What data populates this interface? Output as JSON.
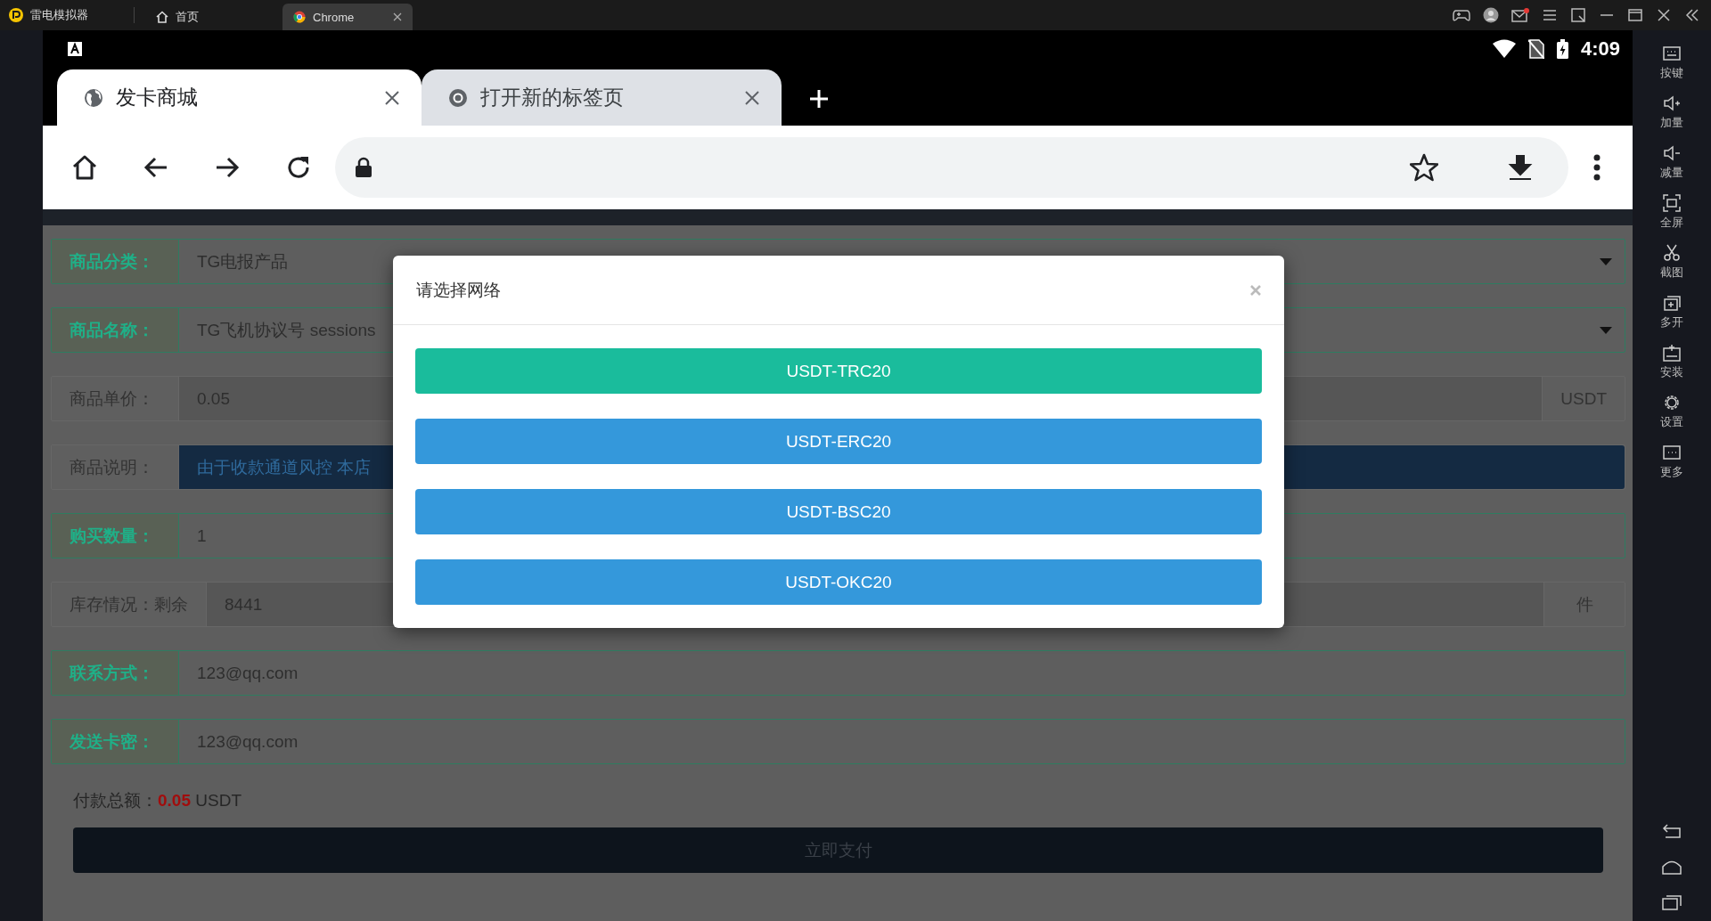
{
  "emulator": {
    "app_name": "雷电模拟器",
    "tabs": [
      {
        "label": "首页",
        "selected": false
      },
      {
        "label": "Chrome",
        "selected": true
      }
    ]
  },
  "sidebar": {
    "items": [
      {
        "label": "按键"
      },
      {
        "label": "加量"
      },
      {
        "label": "减量"
      },
      {
        "label": "全屏"
      },
      {
        "label": "截图"
      },
      {
        "label": "多开"
      },
      {
        "label": "安装"
      },
      {
        "label": "设置"
      },
      {
        "label": "更多"
      }
    ]
  },
  "status_bar": {
    "time": "4:09"
  },
  "browser": {
    "tabs": [
      {
        "title": "发卡商城",
        "selected": true
      },
      {
        "title": "打开新的标签页",
        "selected": false
      }
    ]
  },
  "form": {
    "rows": [
      {
        "label": "商品分类：",
        "value": "TG电报产品",
        "kind": "select",
        "valid": true
      },
      {
        "label": "商品名称：",
        "value": "TG飞机协议号 sessions",
        "kind": "select",
        "valid": true
      },
      {
        "label": "商品单价：",
        "value": "0.05",
        "kind": "readonly",
        "unit": "USDT",
        "valid": false
      },
      {
        "label": "商品说明：",
        "value": "由于收款通道风控 本店",
        "kind": "notice",
        "valid": false
      },
      {
        "label": "购买数量：",
        "value": "1",
        "kind": "text",
        "valid": true
      },
      {
        "label": "库存情况：剩余",
        "value": "8441",
        "kind": "readonly",
        "unit": "件",
        "valid": false
      },
      {
        "label": "联系方式：",
        "value": "123@qq.com",
        "kind": "text",
        "valid": true
      },
      {
        "label": "发送卡密：",
        "value": "123@qq.com",
        "kind": "text",
        "valid": true
      }
    ]
  },
  "total": {
    "label": "付款总额：",
    "amount": "0.05",
    "unit": "USDT"
  },
  "pay_button": "立即支付",
  "modal": {
    "title": "请选择网络",
    "options": [
      {
        "label": "USDT-TRC20",
        "color": "#1abc9c"
      },
      {
        "label": "USDT-ERC20",
        "color": "#3498db"
      },
      {
        "label": "USDT-BSC20",
        "color": "#3498db"
      },
      {
        "label": "USDT-OKC20",
        "color": "#3498db"
      }
    ]
  }
}
